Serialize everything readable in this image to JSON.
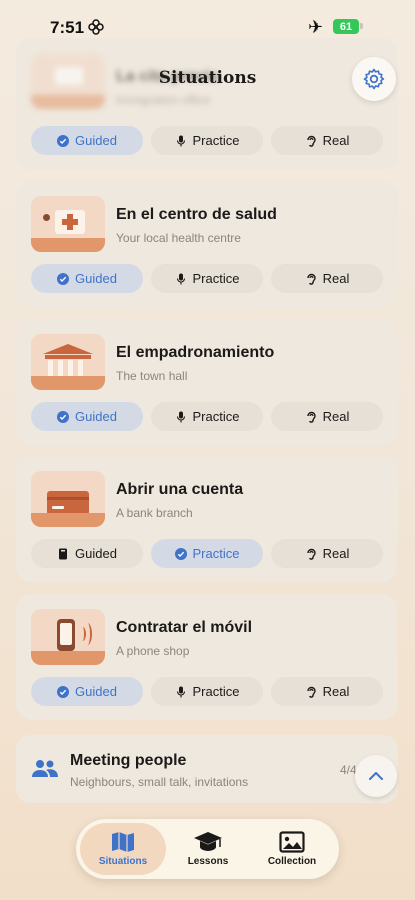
{
  "status": {
    "time": "7:51",
    "battery": "61"
  },
  "header": {
    "title": "Situations"
  },
  "labels": {
    "guided": "Guided",
    "practice": "Practice",
    "real": "Real"
  },
  "cards": [
    {
      "title": "La cita previa",
      "subtitle": "Immigration office"
    },
    {
      "title": "En el centro de salud",
      "subtitle": "Your local health centre"
    },
    {
      "title": "El empadronamiento",
      "subtitle": "The town hall"
    },
    {
      "title": "Abrir una cuenta",
      "subtitle": "A bank branch"
    },
    {
      "title": "Contratar el móvil",
      "subtitle": "A phone shop"
    }
  ],
  "group": {
    "title": "Meeting people",
    "subtitle": "Neighbours, small talk, invitations",
    "count": "4/4"
  },
  "tabs": [
    {
      "label": "Situations"
    },
    {
      "label": "Lessons"
    },
    {
      "label": "Collection"
    }
  ],
  "colors": {
    "accent": "#3f73c9",
    "thumb_accent": "#e2976a"
  }
}
